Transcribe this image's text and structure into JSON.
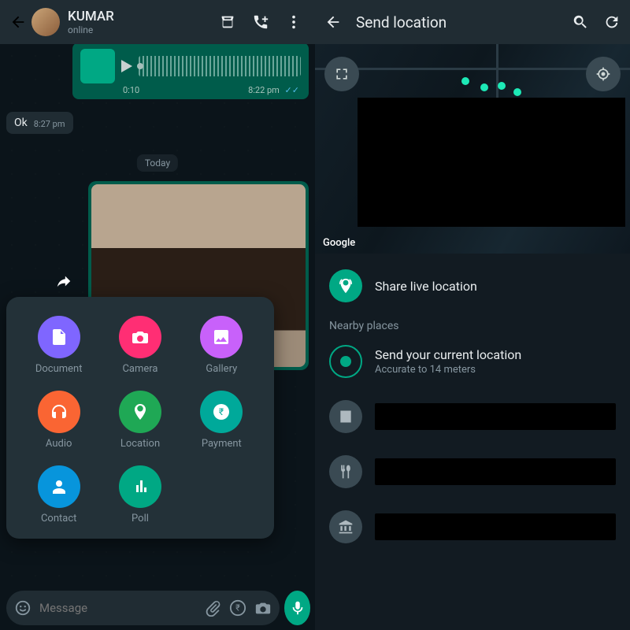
{
  "left": {
    "header": {
      "contact_name": "KUMAR",
      "status": "online"
    },
    "voice_message": {
      "elapsed": "0:10",
      "timestamp": "8:22 pm"
    },
    "incoming": {
      "text": "Ok",
      "time": "8:27 pm"
    },
    "date_separator": "Today",
    "attachment_sheet": {
      "items": [
        {
          "label": "Document",
          "icon": "document-icon",
          "color": "c-doc"
        },
        {
          "label": "Camera",
          "icon": "camera-icon",
          "color": "c-cam"
        },
        {
          "label": "Gallery",
          "icon": "gallery-icon",
          "color": "c-gal"
        },
        {
          "label": "Audio",
          "icon": "audio-icon",
          "color": "c-aud"
        },
        {
          "label": "Location",
          "icon": "location-icon",
          "color": "c-loc"
        },
        {
          "label": "Payment",
          "icon": "payment-icon",
          "color": "c-pay"
        },
        {
          "label": "Contact",
          "icon": "contact-icon",
          "color": "c-con"
        },
        {
          "label": "Poll",
          "icon": "poll-icon",
          "color": "c-poll"
        }
      ]
    },
    "input_placeholder": "Message"
  },
  "right": {
    "title": "Send location",
    "share_live": "Share live location",
    "nearby_label": "Nearby places",
    "current_location": {
      "title": "Send your current location",
      "subtitle": "Accurate to 14 meters"
    },
    "map_credit": "Google"
  }
}
